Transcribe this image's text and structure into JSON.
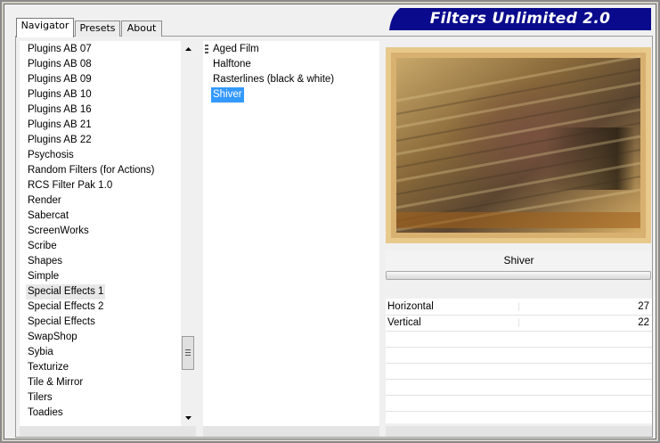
{
  "tabs": [
    {
      "label": "Navigator",
      "active": true
    },
    {
      "label": "Presets",
      "active": false
    },
    {
      "label": "About",
      "active": false
    }
  ],
  "banner": {
    "title": "Filters Unlimited 2.0",
    "color": "#0a0a8c"
  },
  "categories": {
    "items": [
      "Plugins AB 07",
      "Plugins AB 08",
      "Plugins AB 09",
      "Plugins AB 10",
      "Plugins AB 16",
      "Plugins AB 21",
      "Plugins AB 22",
      "Psychosis",
      "Random Filters (for Actions)",
      "RCS Filter Pak 1.0",
      "Render",
      "Sabercat",
      "ScreenWorks",
      "Scribe",
      "Shapes",
      "Simple",
      "Special Effects 1",
      "Special Effects 2",
      "Special Effects",
      "SwapShop",
      "Sybia",
      "Texturize",
      "Tile & Mirror",
      "Tilers",
      "Toadies"
    ],
    "current": "Special Effects 1",
    "scroll_up_icon": "triangle-up",
    "scroll_down_icon": "triangle-down"
  },
  "filters": {
    "items": [
      "Aged Film",
      "Halftone",
      "Rasterlines (black & white)",
      "Shiver"
    ],
    "selected": "Shiver",
    "selected_color": "#3399ff"
  },
  "preview": {
    "filter_name": "Shiver"
  },
  "params": [
    {
      "label": "Horizontal",
      "value": "27"
    },
    {
      "label": "Vertical",
      "value": "22"
    }
  ]
}
